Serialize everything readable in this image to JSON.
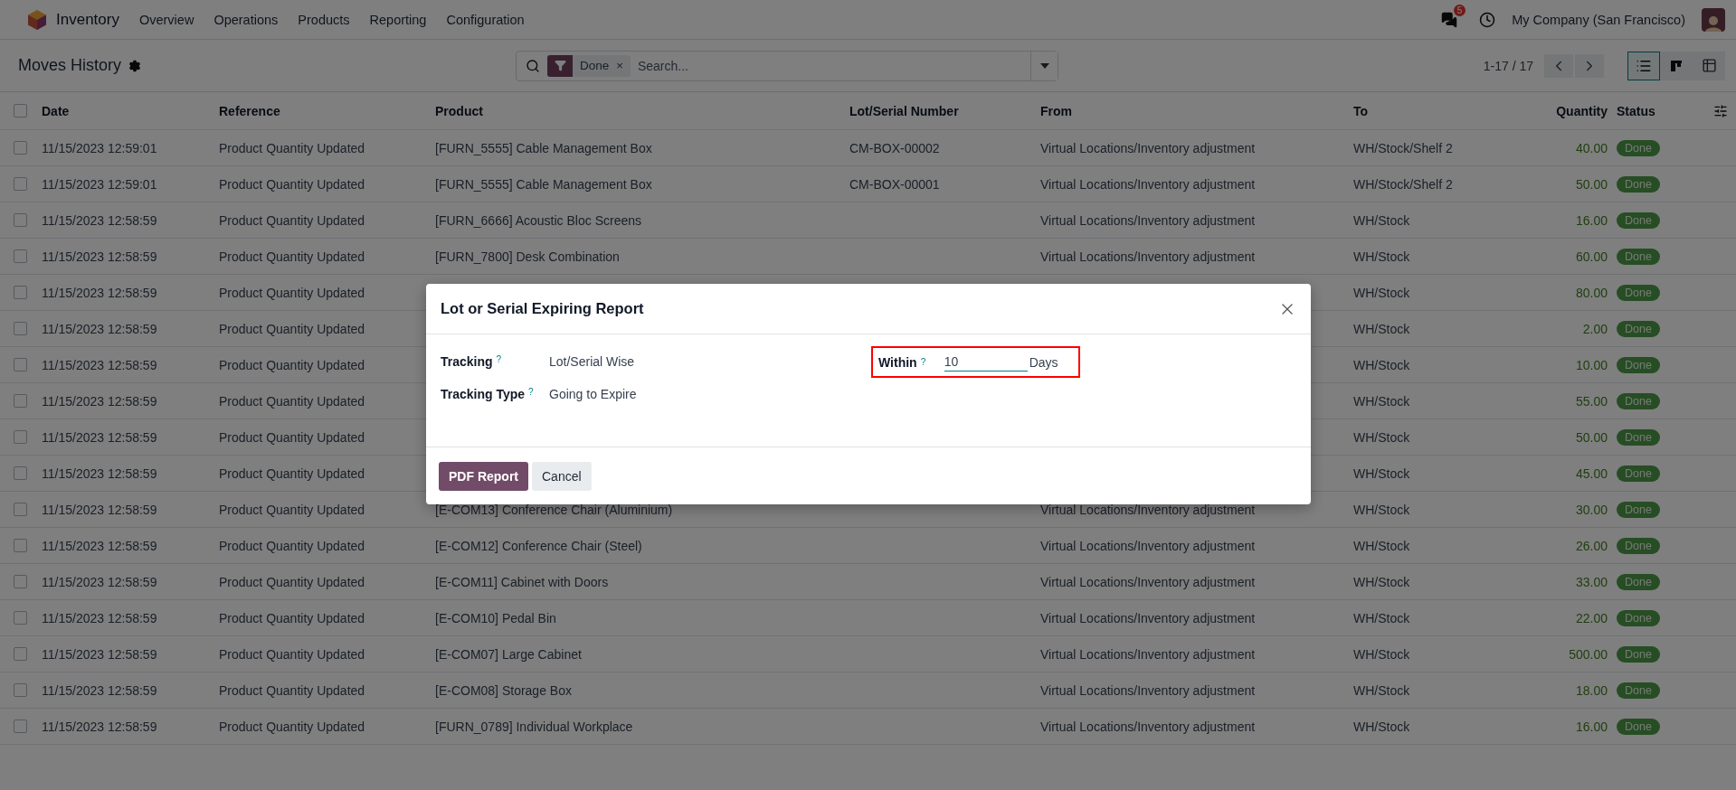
{
  "navbar": {
    "app": "Inventory",
    "menu": [
      "Overview",
      "Operations",
      "Products",
      "Reporting",
      "Configuration"
    ],
    "messages_badge": "5",
    "company": "My Company (San Francisco)"
  },
  "control_panel": {
    "title": "Moves History",
    "facet": {
      "label": "Done",
      "remove": "×"
    },
    "search": {
      "placeholder": "Search..."
    },
    "pager": "1-17 / 17",
    "views": [
      {
        "kind": "list",
        "selected": true
      },
      {
        "kind": "kanban",
        "selected": false
      },
      {
        "kind": "pivot",
        "selected": false
      }
    ]
  },
  "table": {
    "select_all": {
      "checked": false
    },
    "columns": [
      "Date",
      "Reference",
      "Product",
      "Lot/Serial Number",
      "From",
      "To",
      "Quantity",
      "Status"
    ],
    "rows": [
      {
        "checked": false,
        "date": "11/15/2023 12:59:01",
        "reference": "Product Quantity Updated",
        "product": "[FURN_5555] Cable Management Box",
        "lot": "CM-BOX-00002",
        "from": "Virtual Locations/Inventory adjustment",
        "to": "WH/Stock/Shelf 2",
        "quantity": "40.00",
        "status": "Done"
      },
      {
        "checked": false,
        "date": "11/15/2023 12:59:01",
        "reference": "Product Quantity Updated",
        "product": "[FURN_5555] Cable Management Box",
        "lot": "CM-BOX-00001",
        "from": "Virtual Locations/Inventory adjustment",
        "to": "WH/Stock/Shelf 2",
        "quantity": "50.00",
        "status": "Done"
      },
      {
        "checked": false,
        "date": "11/15/2023 12:58:59",
        "reference": "Product Quantity Updated",
        "product": "[FURN_6666] Acoustic Bloc Screens",
        "from": "Virtual Locations/Inventory adjustment",
        "to": "WH/Stock",
        "quantity": "16.00",
        "status": "Done"
      },
      {
        "checked": false,
        "date": "11/15/2023 12:58:59",
        "reference": "Product Quantity Updated",
        "product": "[FURN_7800] Desk Combination",
        "from": "Virtual Locations/Inventory adjustment",
        "to": "WH/Stock",
        "quantity": "60.00",
        "status": "Done"
      },
      {
        "checked": false,
        "date": "11/15/2023 12:58:59",
        "reference": "Product Quantity Updated",
        "to": "WH/Stock",
        "quantity": "80.00",
        "status": "Done"
      },
      {
        "checked": false,
        "date": "11/15/2023 12:58:59",
        "reference": "Product Quantity Updated",
        "to": "WH/Stock",
        "quantity": "2.00",
        "status": "Done"
      },
      {
        "checked": false,
        "date": "11/15/2023 12:58:59",
        "reference": "Product Quantity Updated",
        "to": "WH/Stock",
        "quantity": "10.00",
        "status": "Done"
      },
      {
        "checked": false,
        "date": "11/15/2023 12:58:59",
        "reference": "Product Quantity Updated",
        "to": "WH/Stock",
        "quantity": "55.00",
        "status": "Done"
      },
      {
        "checked": false,
        "date": "11/15/2023 12:58:59",
        "reference": "Product Quantity Updated",
        "to": "WH/Stock",
        "quantity": "50.00",
        "status": "Done"
      },
      {
        "checked": false,
        "date": "11/15/2023 12:58:59",
        "reference": "Product Quantity Updated",
        "to": "WH/Stock",
        "quantity": "45.00",
        "status": "Done"
      },
      {
        "checked": false,
        "date": "11/15/2023 12:58:59",
        "reference": "Product Quantity Updated",
        "product": "[E-COM13] Conference Chair (Aluminium)",
        "from": "Virtual Locations/Inventory adjustment",
        "to": "WH/Stock",
        "quantity": "30.00",
        "status": "Done"
      },
      {
        "checked": false,
        "date": "11/15/2023 12:58:59",
        "reference": "Product Quantity Updated",
        "product": "[E-COM12] Conference Chair (Steel)",
        "from": "Virtual Locations/Inventory adjustment",
        "to": "WH/Stock",
        "quantity": "26.00",
        "status": "Done"
      },
      {
        "checked": false,
        "date": "11/15/2023 12:58:59",
        "reference": "Product Quantity Updated",
        "product": "[E-COM11] Cabinet with Doors",
        "from": "Virtual Locations/Inventory adjustment",
        "to": "WH/Stock",
        "quantity": "33.00",
        "status": "Done"
      },
      {
        "checked": false,
        "date": "11/15/2023 12:58:59",
        "reference": "Product Quantity Updated",
        "product": "[E-COM10] Pedal Bin",
        "from": "Virtual Locations/Inventory adjustment",
        "to": "WH/Stock",
        "quantity": "22.00",
        "status": "Done"
      },
      {
        "checked": false,
        "date": "11/15/2023 12:58:59",
        "reference": "Product Quantity Updated",
        "product": "[E-COM07] Large Cabinet",
        "from": "Virtual Locations/Inventory adjustment",
        "to": "WH/Stock",
        "quantity": "500.00",
        "status": "Done"
      },
      {
        "checked": false,
        "date": "11/15/2023 12:58:59",
        "reference": "Product Quantity Updated",
        "product": "[E-COM08] Storage Box",
        "from": "Virtual Locations/Inventory adjustment",
        "to": "WH/Stock",
        "quantity": "18.00",
        "status": "Done"
      },
      {
        "checked": false,
        "date": "11/15/2023 12:58:59",
        "reference": "Product Quantity Updated",
        "product": "[FURN_0789] Individual Workplace",
        "from": "Virtual Locations/Inventory adjustment",
        "to": "WH/Stock",
        "quantity": "16.00",
        "status": "Done"
      }
    ]
  },
  "dialog": {
    "title": "Lot or Serial Expiring Report",
    "left_fields": [
      {
        "label": "Tracking",
        "help": "?",
        "value": "Lot/Serial Wise"
      },
      {
        "label": "Tracking Type",
        "help": "?",
        "value": "Going to Expire"
      }
    ],
    "within": {
      "label": "Within",
      "help": "?",
      "value": "10",
      "unit": "Days",
      "highlighted": true
    },
    "buttons": [
      {
        "label": "PDF Report",
        "kind": "primary"
      },
      {
        "label": "Cancel",
        "kind": "secondary"
      }
    ]
  }
}
